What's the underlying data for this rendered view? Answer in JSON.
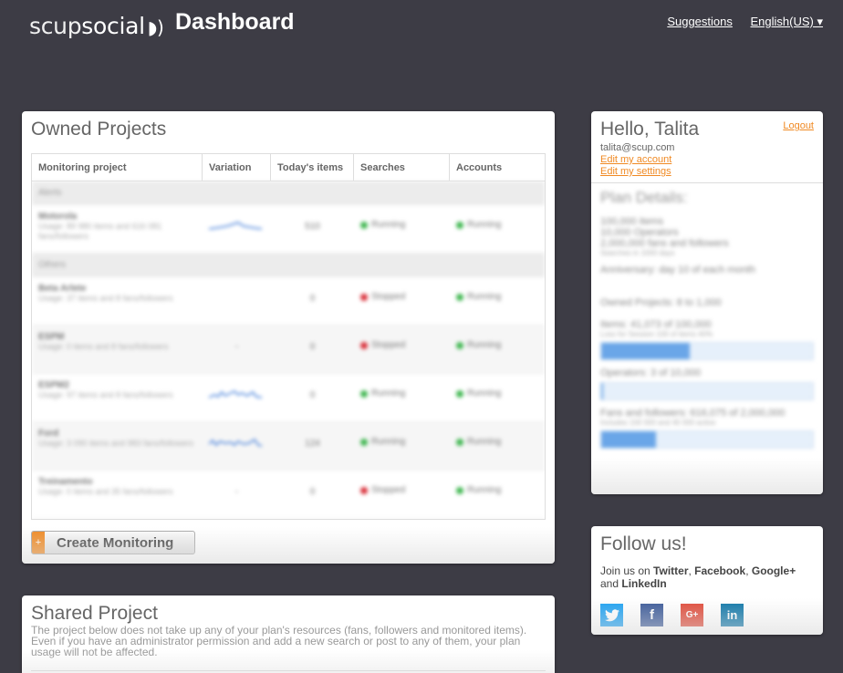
{
  "header": {
    "logo_thin": "scup",
    "logo_main": "social",
    "title": "Dashboard",
    "links": [
      "Suggestions",
      "English(US) ▾"
    ]
  },
  "owned": {
    "title": "Owned Projects",
    "columns": [
      "Monitoring project",
      "Variation",
      "Today's items",
      "Searches",
      "Accounts"
    ],
    "groups": [
      "Alerts",
      "Others"
    ],
    "rows": [
      {
        "name": "Motorola",
        "sub": "Usage: 89 980 items and 616 081 fans/followers",
        "count": "510",
        "search": "Running",
        "search_status": "g",
        "account": "Running"
      },
      {
        "name": "Beta Arlete",
        "sub": "Usage: 37 items and 8 fans/followers",
        "count": "0",
        "search": "Stopped",
        "search_status": "r",
        "account": "Running"
      },
      {
        "name": "ESPM",
        "sub": "Usage: 0 items and 8 fans/followers",
        "count": "0",
        "search": "Stopped",
        "search_status": "r",
        "account": "Running"
      },
      {
        "name": "ESPM2",
        "sub": "Usage: 97 items and 8 fans/followers",
        "count": "0",
        "search": "Running",
        "search_status": "g",
        "account": "Running"
      },
      {
        "name": "Ford",
        "sub": "Usage: 3 090 items and 983 fans/followers",
        "count": "124",
        "search": "Running",
        "search_status": "g",
        "account": "Running"
      },
      {
        "name": "Treinamento",
        "sub": "Usage: 0 items and 35 fans/followers",
        "count": "0",
        "search": "Stopped",
        "search_status": "r",
        "account": "Running"
      }
    ],
    "create_label": "Create Monitoring"
  },
  "shared": {
    "title": "Shared Project",
    "desc": "The project below does not take up any of your plan's resources (fans, followers and monitored items). Even if you have an administrator permission and add a new search or post to any of them, your plan usage will not be affected."
  },
  "account": {
    "greeting": "Hello, Talita",
    "logout": "Logout",
    "email": "talita@scup.com",
    "edit_account": "Edit my account",
    "edit_settings": "Edit my settings"
  },
  "plan": {
    "title": "Plan Details:",
    "lines": [
      "100,000 items",
      "10,000 Operators",
      "2,000,000 fans and followers"
    ],
    "sub": "Searches in 1000 days",
    "anniversary": "Anniversary: day 10 of each month",
    "owned_projects": "Owned Projects: 8 to 1,000",
    "items": "Items: 41,073 of 100,000",
    "items_sub": "Loss for Session 100 of items 40%",
    "items_pct": 42,
    "operators": "Operators: 3 of 10,000",
    "operators_pct": 1,
    "fans": "Fans and followers: 616,075 of 2,000,000",
    "fans_sub": "Includes 100 000 and 40 000 active",
    "fans_pct": 26
  },
  "follow": {
    "title": "Follow us!",
    "text_prefix": "Join us on",
    "networks": [
      "Twitter",
      "Facebook",
      "Google+",
      "LinkedIn"
    ],
    "and": "and"
  },
  "colors": {
    "accent": "#f08a24",
    "background": "#3d3c45",
    "running": "#3fb650",
    "stopped": "#d9303a"
  }
}
